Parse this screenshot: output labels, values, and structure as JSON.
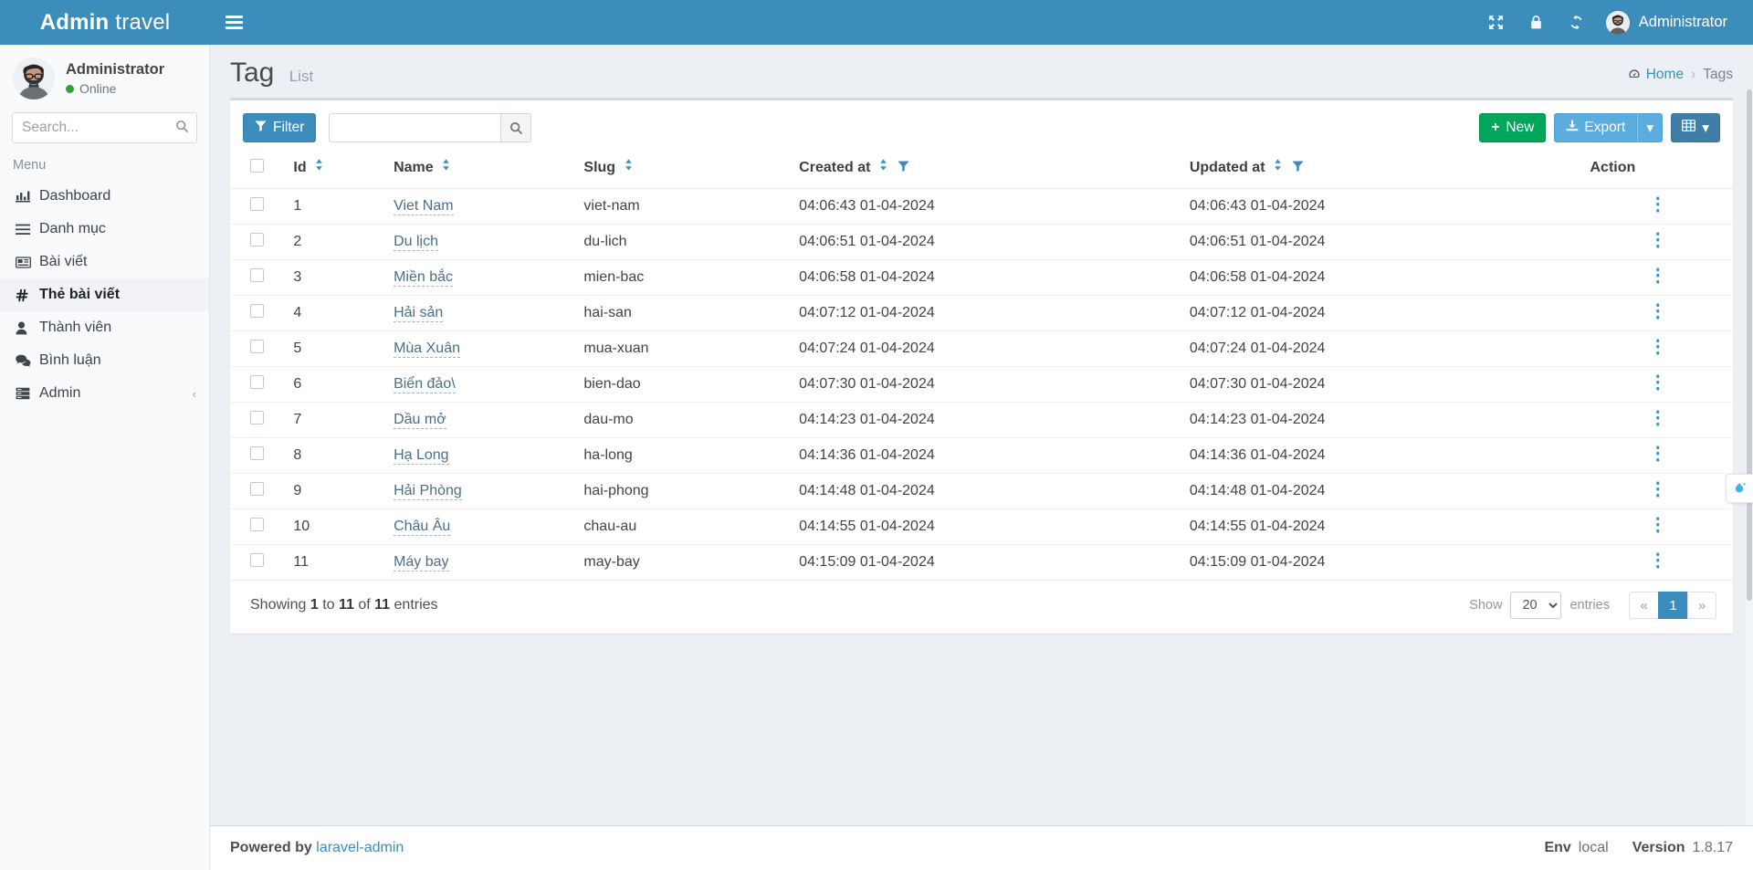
{
  "header": {
    "logo_bold": "Admin",
    "logo_light": "travel",
    "toggle_label": "Toggle navigation",
    "icons": [
      {
        "name": "fullscreen-icon",
        "glyph": "⤢"
      },
      {
        "name": "lock-icon",
        "glyph": "🔒"
      },
      {
        "name": "refresh-icon",
        "glyph": "⟳"
      }
    ],
    "user_name": "Administrator"
  },
  "sidebar": {
    "user": {
      "name": "Administrator",
      "status": "Online"
    },
    "search_placeholder": "Search...",
    "search_value": "",
    "menu_header": "Menu",
    "items": [
      {
        "label": "Dashboard",
        "icon": "bar-chart-icon",
        "active": false
      },
      {
        "label": "Danh mục",
        "icon": "list-icon",
        "active": false
      },
      {
        "label": "Bài viết",
        "icon": "newspaper-icon",
        "active": false
      },
      {
        "label": "Thẻ bài viết",
        "icon": "hashtag-icon",
        "active": true
      },
      {
        "label": "Thành viên",
        "icon": "user-icon",
        "active": false
      },
      {
        "label": "Bình luận",
        "icon": "comments-icon",
        "active": false
      },
      {
        "label": "Admin",
        "icon": "server-icon",
        "active": false,
        "chevron": "‹"
      }
    ]
  },
  "content": {
    "title": "Tag",
    "subtitle": "List",
    "breadcrumb": {
      "home": "Home",
      "separator": "›",
      "current": "Tags"
    }
  },
  "toolbar": {
    "filter_label": "Filter",
    "search_placeholder": "",
    "search_value": "",
    "new_label": "New",
    "export_label": "Export",
    "caret": "▾"
  },
  "table": {
    "columns": [
      {
        "key": "check",
        "label": ""
      },
      {
        "key": "id",
        "label": "Id",
        "sortable": true
      },
      {
        "key": "name",
        "label": "Name",
        "sortable": true
      },
      {
        "key": "slug",
        "label": "Slug",
        "sortable": true
      },
      {
        "key": "created_at",
        "label": "Created at",
        "sortable": true,
        "filter": true
      },
      {
        "key": "updated_at",
        "label": "Updated at",
        "sortable": true,
        "filter": true
      },
      {
        "key": "action",
        "label": "Action"
      }
    ],
    "rows": [
      {
        "id": "1",
        "name": "Viet Nam",
        "slug": "viet-nam",
        "created_at": "04:06:43 01-04-2024",
        "updated_at": "04:06:43 01-04-2024"
      },
      {
        "id": "2",
        "name": "Du lịch",
        "slug": "du-lich",
        "created_at": "04:06:51 01-04-2024",
        "updated_at": "04:06:51 01-04-2024"
      },
      {
        "id": "3",
        "name": "Miền bắc",
        "slug": "mien-bac",
        "created_at": "04:06:58 01-04-2024",
        "updated_at": "04:06:58 01-04-2024"
      },
      {
        "id": "4",
        "name": "Hải sản",
        "slug": "hai-san",
        "created_at": "04:07:12 01-04-2024",
        "updated_at": "04:07:12 01-04-2024"
      },
      {
        "id": "5",
        "name": "Mùa Xuân",
        "slug": "mua-xuan",
        "created_at": "04:07:24 01-04-2024",
        "updated_at": "04:07:24 01-04-2024"
      },
      {
        "id": "6",
        "name": "Biển đảo\\",
        "slug": "bien-dao",
        "created_at": "04:07:30 01-04-2024",
        "updated_at": "04:07:30 01-04-2024"
      },
      {
        "id": "7",
        "name": "Dầu mở",
        "slug": "dau-mo",
        "created_at": "04:14:23 01-04-2024",
        "updated_at": "04:14:23 01-04-2024"
      },
      {
        "id": "8",
        "name": "Hạ Long",
        "slug": "ha-long",
        "created_at": "04:14:36 01-04-2024",
        "updated_at": "04:14:36 01-04-2024"
      },
      {
        "id": "9",
        "name": "Hải Phòng",
        "slug": "hai-phong",
        "created_at": "04:14:48 01-04-2024",
        "updated_at": "04:14:48 01-04-2024"
      },
      {
        "id": "10",
        "name": "Châu Âu",
        "slug": "chau-au",
        "created_at": "04:14:55 01-04-2024",
        "updated_at": "04:14:55 01-04-2024"
      },
      {
        "id": "11",
        "name": "Máy bay",
        "slug": "may-bay",
        "created_at": "04:15:09 01-04-2024",
        "updated_at": "04:15:09 01-04-2024"
      }
    ],
    "action_glyph": "⋮"
  },
  "footer_bar": {
    "showing_prefix": "Showing",
    "showing_from": "1",
    "showing_to_word": "to",
    "showing_to": "11",
    "showing_of_word": "of",
    "showing_total": "11",
    "showing_suffix": "entries",
    "show_label": "Show",
    "page_length": "20",
    "entries_label": "entries",
    "prev": "«",
    "page_current": "1",
    "next": "»"
  },
  "page_footer": {
    "powered_prefix": "Powered by",
    "powered_link": "laravel-admin",
    "env_label": "Env",
    "env_value": "local",
    "version_label": "Version",
    "version_value": "1.8.17"
  },
  "colors": {
    "brand": "#3c8dbc",
    "success": "#00a65a",
    "info": "#5bacdf",
    "dark_accent": "#3f7ea6",
    "online": "#3a9c3a",
    "link": "#3c8dbc"
  }
}
